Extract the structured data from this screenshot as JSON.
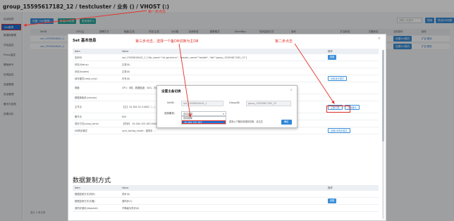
{
  "header": {
    "title": "group_15595617182_12 / testcluster / 业务 () / VHOST (:)"
  },
  "sidebar": {
    "items": [
      {
        "label": "后台巡查"
      },
      {
        "label": "Set管理",
        "active": true
      },
      {
        "label": "数据库管理"
      },
      {
        "label": "评估监控"
      },
      {
        "label": "Proxy监控"
      },
      {
        "label": "基础命令"
      },
      {
        "label": "实例监控"
      },
      {
        "label": "容量管理"
      },
      {
        "label": "安全管理"
      },
      {
        "label": "备份与回档"
      },
      {
        "label": "告警分析"
      }
    ]
  },
  "toolbar": {
    "btn1": "设置（Set管理）",
    "btn2": "新增Set实例",
    "btn3": "更多操作 ▾",
    "search_placeholder": "请输入关键字",
    "search_btn": "搜索",
    "export_btn": "导出Set列表"
  },
  "main_table": {
    "headers": [
      "SetID",
      "CPU/主",
      "部署方式",
      "磁盘/主机",
      "内存/主机",
      "分片数",
      "实例状态",
      "集群模式",
      "ShardKey",
      "同步复制方式",
      "读写",
      "扩容状态",
      "灾备状态",
      "当前操作",
      "操作"
    ],
    "rows": [
      {
        "setid": "set_15595618441_1",
        "op1": "设置Set模式",
        "op2": "扩容 删除"
      },
      {
        "setid": "set_15595618441_2",
        "op1": "设置Set模式",
        "op2": "扩容 删除"
      }
    ]
  },
  "footer": {
    "text": "显示 2 条记录"
  },
  "info_modal": {
    "title": "Set 基本信息",
    "close": "×",
    "col_key": "Item",
    "col_value": "Value",
    "col_op": "操作",
    "rows": [
      {
        "key": "实例ID",
        "value": "set_15595618441_1 {\"db_name\":\"dc-gd-mirror\", \"master_name\":\"testdb\", \"db\":\"group_15595617182_12\"}",
        "op": "查看"
      },
      {
        "key": "状态(Status)",
        "value": "正常(0)"
      },
      {
        "key": "状态(Isolate)",
        "value": "正常(0)"
      },
      {
        "key": "读写模式(read_only)",
        "value": "可写(0)",
        "op": "设置读写模式"
      },
      {
        "key": "规格",
        "value": "CPU：8核，数据磁盘：50G，内存：4G ...",
        "tall": true
      },
      {
        "key": "数据库版本(version)",
        "value": ""
      },
      {
        "key": "主节点",
        "value": "【主】10.164.52.2:4002（...）",
        "tall": true,
        "op": "主备切换",
        "op2": "设置备机"
      },
      {
        "key": "备节点",
        "value": "N/A"
      },
      {
        "key": "同步方式(proxy_bind)",
        "value": "【同步】 10.164.155.183:4002 ..."
      },
      {
        "key": "DB同步模式",
        "value": "sync_binlog_mode：强同步 ...",
        "op": "设置DB同步模式"
      }
    ],
    "section_title": "数据复制方式",
    "rows2": [
      {
        "key": "数据复制方式(同步)",
        "value": "异步(0)"
      },
      {
        "key": "数据复制方式(灾备)",
        "value": "强同步(1)",
        "op": "设置"
      },
      {
        "key": "强同步退化(degrade)",
        "value": "不降级为异步(0)"
      }
    ]
  },
  "switch_modal": {
    "title": "设置主备切换",
    "close": "×",
    "setid_label": "SetID:",
    "setid_value": "set_15595618441_1",
    "groupid_label": "GroupID:",
    "groupid_value": "group_15595617182_12",
    "target_label": "选择备机:",
    "select_value": "自动选择",
    "options": [
      "自动选择",
      "10.164.155.183"
    ],
    "hint": "若到以下备机则强制切换，请注意",
    "ok": "确定"
  },
  "annotations": {
    "step1": "第一步点击",
    "step2": "第二步点击",
    "step3": "第三步点击，选择一个备DB切换为主DB"
  }
}
